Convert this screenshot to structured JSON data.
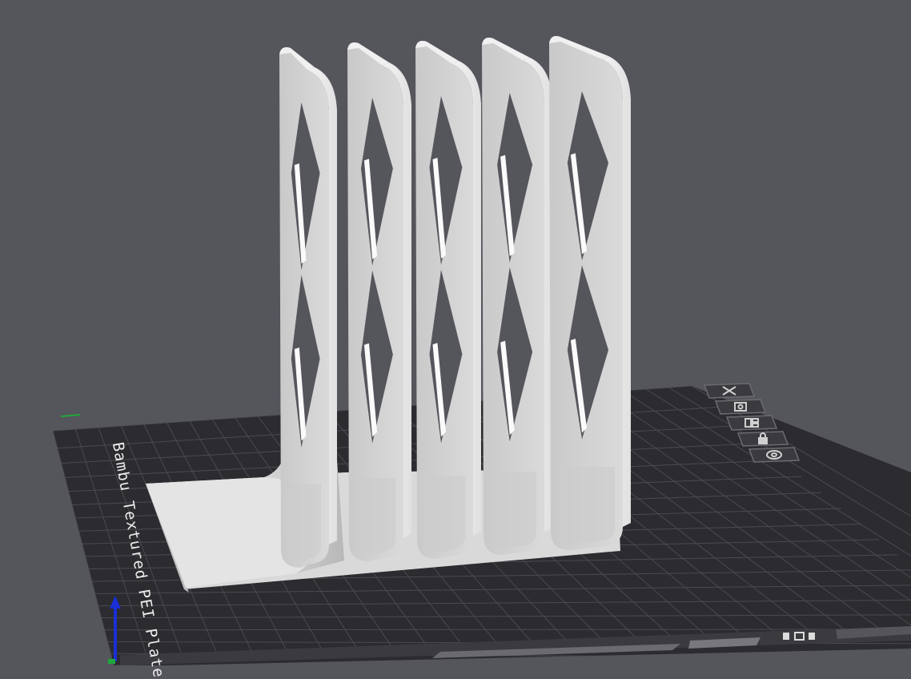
{
  "plate": {
    "label": "Bambu Textured PEI Plate"
  },
  "plate_tools": [
    {
      "name": "remove-plate-button",
      "icon": "close-icon"
    },
    {
      "name": "orient-plate-button",
      "icon": "orient-icon"
    },
    {
      "name": "arrange-plate-button",
      "icon": "arrange-icon"
    },
    {
      "name": "lock-plate-button",
      "icon": "lock-icon"
    },
    {
      "name": "plate-settings-button",
      "icon": "settings-icon"
    }
  ],
  "axes": {
    "x_color": "#d92020",
    "y_color": "#1fa83a",
    "z_color": "#1a2fd8"
  },
  "colors": {
    "background": "#55555c",
    "plate": "#2b2b30",
    "grid": "#4a4a50",
    "model": "#e2e2e2"
  }
}
